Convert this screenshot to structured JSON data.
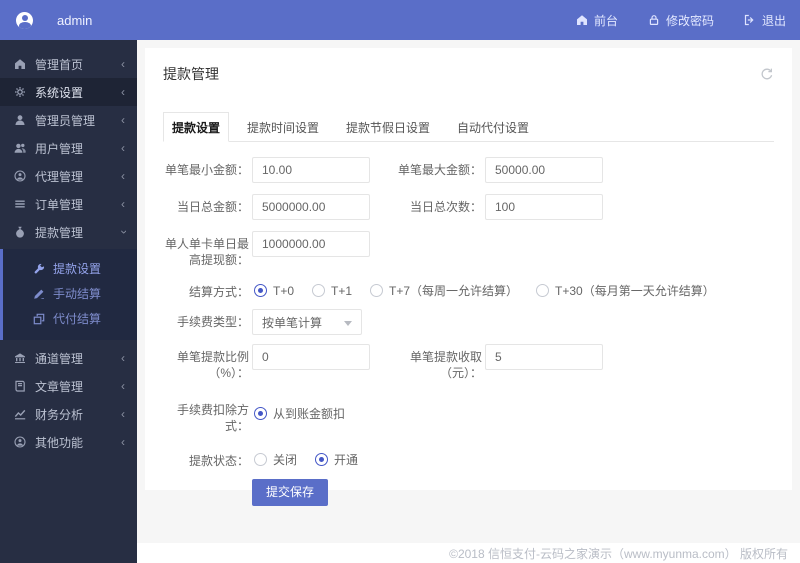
{
  "header": {
    "username": "admin",
    "nav": {
      "front": "前台",
      "change_password": "修改密码",
      "logout": "退出"
    }
  },
  "sidebar": {
    "items": [
      {
        "label": "管理首页",
        "icon": "home-icon"
      },
      {
        "label": "系统设置",
        "icon": "gear-icon",
        "active": true
      },
      {
        "label": "管理员管理",
        "icon": "admin-user-icon"
      },
      {
        "label": "用户管理",
        "icon": "users-icon"
      },
      {
        "label": "代理管理",
        "icon": "agent-icon"
      },
      {
        "label": "订单管理",
        "icon": "orders-icon"
      },
      {
        "label": "提款管理",
        "icon": "withdraw-icon",
        "expanded": true
      },
      {
        "label": "通道管理",
        "icon": "bank-icon"
      },
      {
        "label": "文章管理",
        "icon": "article-icon"
      },
      {
        "label": "财务分析",
        "icon": "chart-icon"
      },
      {
        "label": "其他功能",
        "icon": "other-icon"
      }
    ],
    "submenu": [
      {
        "label": "提款设置",
        "icon": "wrench-icon",
        "active": true
      },
      {
        "label": "手动结算",
        "icon": "signature-icon"
      },
      {
        "label": "代付结算",
        "icon": "clone-icon"
      }
    ]
  },
  "card": {
    "title": "提款管理",
    "tabs": [
      {
        "label": "提款设置",
        "active": true
      },
      {
        "label": "提款时间设置"
      },
      {
        "label": "提款节假日设置"
      },
      {
        "label": "自动代付设置"
      }
    ]
  },
  "form": {
    "min_amount": {
      "label": "单笔最小金额：",
      "value": "10.00"
    },
    "max_amount": {
      "label": "单笔最大金额：",
      "value": "50000.00"
    },
    "daily_total": {
      "label": "当日总金额：",
      "value": "5000000.00"
    },
    "daily_count": {
      "label": "当日总次数：",
      "value": "100"
    },
    "per_card_daily_max": {
      "label": "单人单卡单日最高提现额：",
      "value": "1000000.00"
    },
    "settle_mode": {
      "label": "结算方式：",
      "options": [
        "T+0",
        "T+1",
        "T+7（每周一允许结算）",
        "T+30（每月第一天允许结算）"
      ],
      "selected": "T+0"
    },
    "fee_type": {
      "label": "手续费类型：",
      "value": "按单笔计算"
    },
    "fee_percent": {
      "label": "单笔提款比例（%）：",
      "value": "0"
    },
    "fee_fixed": {
      "label": "单笔提款收取（元）：",
      "value": "5"
    },
    "fee_deduct": {
      "label": "手续费扣除方式：",
      "options": [
        "从到账金额扣"
      ],
      "selected": "从到账金额扣"
    },
    "withdraw_status": {
      "label": "提款状态：",
      "options": [
        "关闭",
        "开通"
      ],
      "selected": "开通"
    },
    "submit_label": "提交保存"
  },
  "footer": {
    "copyright": "©2018 信恒支付-云码之家演示（www.myunma.com） 版权所有"
  },
  "colors": {
    "accent": "#5a6ec8",
    "sidebar_bg": "#272e43",
    "radio_active": "#4356c6",
    "page_bg": "#f6f6f6"
  }
}
